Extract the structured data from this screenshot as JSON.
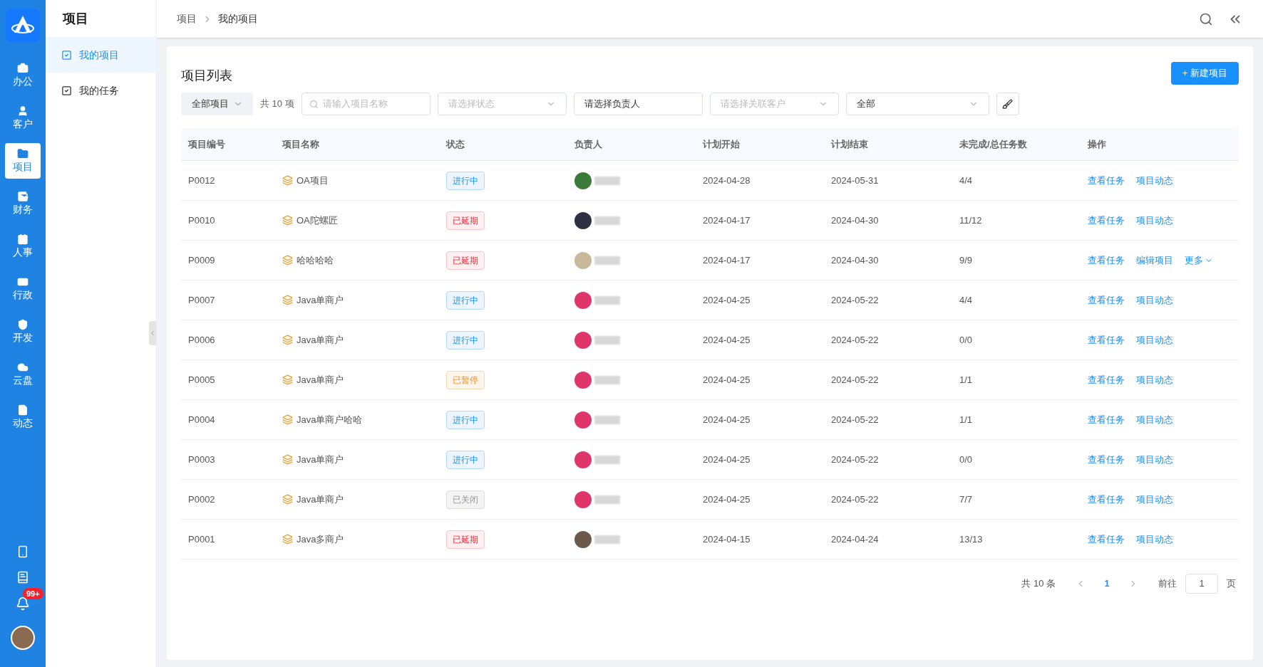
{
  "rail": {
    "items": [
      {
        "label": "办公",
        "selected": false
      },
      {
        "label": "客户",
        "selected": false
      },
      {
        "label": "项目",
        "selected": true
      },
      {
        "label": "财务",
        "selected": false
      },
      {
        "label": "人事",
        "selected": false
      },
      {
        "label": "行政",
        "selected": false
      },
      {
        "label": "开发",
        "selected": false
      },
      {
        "label": "云盘",
        "selected": false
      },
      {
        "label": "动态",
        "selected": false
      }
    ],
    "badge": "99+"
  },
  "submenu": {
    "title": "项目",
    "items": [
      {
        "label": "我的项目",
        "selected": true
      },
      {
        "label": "我的任务",
        "selected": false
      }
    ]
  },
  "breadcrumb": [
    "项目",
    "我的项目"
  ],
  "page": {
    "title": "项目列表",
    "new_button": "+ 新建项目",
    "filters": {
      "scope": "全部项目",
      "count": "共 10 项",
      "search_placeholder": "请输入项目名称",
      "status_placeholder": "请选择状态",
      "owner_value": "请选择负责人",
      "customer_placeholder": "请选择关联客户",
      "range_value": "全部"
    }
  },
  "table": {
    "columns": [
      "项目编号",
      "项目名称",
      "状态",
      "负责人",
      "计划开始",
      "计划结束",
      "未完成/总任务数",
      "操作"
    ],
    "rows": [
      {
        "id": "P0012",
        "name": "OA项目",
        "status": {
          "text": "进行中",
          "kind": "active"
        },
        "start": "2024-04-28",
        "end": "2024-05-31",
        "tasks": "4/4",
        "actions": [
          "查看任务",
          "项目动态"
        ]
      },
      {
        "id": "P0010",
        "name": "OA陀螺匠",
        "status": {
          "text": "已延期",
          "kind": "delayed"
        },
        "start": "2024-04-17",
        "end": "2024-04-30",
        "tasks": "11/12",
        "actions": [
          "查看任务",
          "项目动态"
        ]
      },
      {
        "id": "P0009",
        "name": "哈哈哈哈",
        "status": {
          "text": "已延期",
          "kind": "delayed"
        },
        "start": "2024-04-17",
        "end": "2024-04-30",
        "tasks": "9/9",
        "actions": [
          "查看任务",
          "编辑项目",
          "更多"
        ]
      },
      {
        "id": "P0007",
        "name": "Java单商户",
        "status": {
          "text": "进行中",
          "kind": "active"
        },
        "start": "2024-04-25",
        "end": "2024-05-22",
        "tasks": "4/4",
        "actions": [
          "查看任务",
          "项目动态"
        ]
      },
      {
        "id": "P0006",
        "name": "Java单商户",
        "status": {
          "text": "进行中",
          "kind": "active"
        },
        "start": "2024-04-25",
        "end": "2024-05-22",
        "tasks": "0/0",
        "actions": [
          "查看任务",
          "项目动态"
        ]
      },
      {
        "id": "P0005",
        "name": "Java单商户",
        "status": {
          "text": "已暂停",
          "kind": "paused"
        },
        "start": "2024-04-25",
        "end": "2024-05-22",
        "tasks": "1/1",
        "actions": [
          "查看任务",
          "项目动态"
        ]
      },
      {
        "id": "P0004",
        "name": "Java单商户哈哈",
        "status": {
          "text": "进行中",
          "kind": "active"
        },
        "start": "2024-04-25",
        "end": "2024-05-22",
        "tasks": "1/1",
        "actions": [
          "查看任务",
          "项目动态"
        ]
      },
      {
        "id": "P0003",
        "name": "Java单商户",
        "status": {
          "text": "进行中",
          "kind": "active"
        },
        "start": "2024-04-25",
        "end": "2024-05-22",
        "tasks": "0/0",
        "actions": [
          "查看任务",
          "项目动态"
        ]
      },
      {
        "id": "P0002",
        "name": "Java单商户",
        "status": {
          "text": "已关闭",
          "kind": "closed"
        },
        "start": "2024-04-25",
        "end": "2024-05-22",
        "tasks": "7/7",
        "actions": [
          "查看任务",
          "项目动态"
        ]
      },
      {
        "id": "P0001",
        "name": "Java多商户",
        "status": {
          "text": "已延期",
          "kind": "delayed"
        },
        "start": "2024-04-15",
        "end": "2024-04-24",
        "tasks": "13/13",
        "actions": [
          "查看任务",
          "项目动态"
        ]
      }
    ]
  },
  "pagination": {
    "total": "共 10 条",
    "pages": [
      {
        "label": "1",
        "selected": true
      }
    ],
    "goto_label": "前往",
    "goto_value": "1",
    "page_suffix": "页"
  }
}
